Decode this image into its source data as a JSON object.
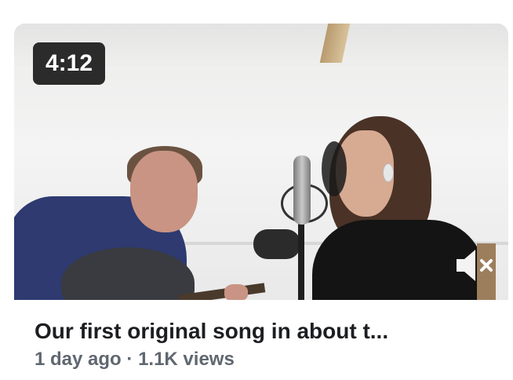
{
  "video": {
    "duration": "4:12",
    "title": "Our first original song in about t...",
    "age": "1 day ago",
    "separator": "·",
    "views": "1.1K views",
    "mute_icon": "speaker-muted-icon"
  }
}
